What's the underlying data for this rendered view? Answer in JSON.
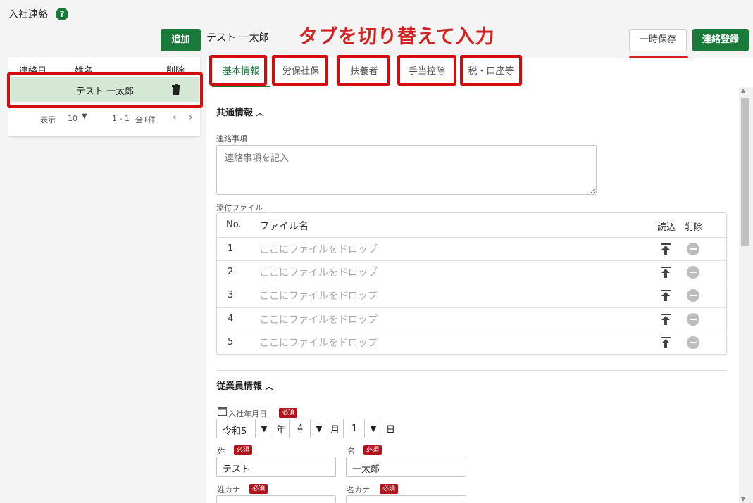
{
  "header": {
    "app_title": "入社連絡",
    "help": "?",
    "add_label": "追加",
    "employee_name": "テスト 一太郎",
    "annotation": "タブを切り替えて入力",
    "temp_save_label": "一時保存",
    "register_label": "連絡登録"
  },
  "list": {
    "col_date": "連絡日",
    "col_name": "姓名",
    "col_delete": "削除",
    "rows": [
      {
        "name": "テスト 一太郎"
      }
    ],
    "pager": {
      "show_label": "表示",
      "per_page": "10",
      "range": "1 - 1",
      "total": "全1件"
    }
  },
  "tabs": [
    {
      "label": "基本情報",
      "active": true
    },
    {
      "label": "労保社保"
    },
    {
      "label": "扶養者"
    },
    {
      "label": "手当控除"
    },
    {
      "label": "税・口座等"
    }
  ],
  "common": {
    "title": "共通情報",
    "memo_label": "連絡事項",
    "memo_placeholder": "連絡事項を記入",
    "attach_label": "添付ファイル",
    "file_table": {
      "col_no": "No.",
      "col_name": "ファイル名",
      "col_read": "読込",
      "col_delete": "削除",
      "rows": [
        {
          "no": "1",
          "placeholder": "ここにファイルをドロップ"
        },
        {
          "no": "2",
          "placeholder": "ここにファイルをドロップ"
        },
        {
          "no": "3",
          "placeholder": "ここにファイルをドロップ"
        },
        {
          "no": "4",
          "placeholder": "ここにファイルをドロップ"
        },
        {
          "no": "5",
          "placeholder": "ここにファイルをドロップ"
        }
      ]
    }
  },
  "employee": {
    "title": "従業員情報",
    "hire_date_label": "入社年月日",
    "required": "必須",
    "era": "令和5",
    "year_unit": "年",
    "month": "4",
    "month_unit": "月",
    "day": "1",
    "day_unit": "日",
    "last_name_label": "姓",
    "last_name": "テスト",
    "first_name_label": "名",
    "first_name": "一太郎",
    "last_kana_label": "姓カナ",
    "first_kana_label": "名カナ"
  },
  "colors": {
    "accent": "#1a7a3a",
    "highlight": "#d30d0d",
    "row_selected": "#d5e8d4"
  }
}
